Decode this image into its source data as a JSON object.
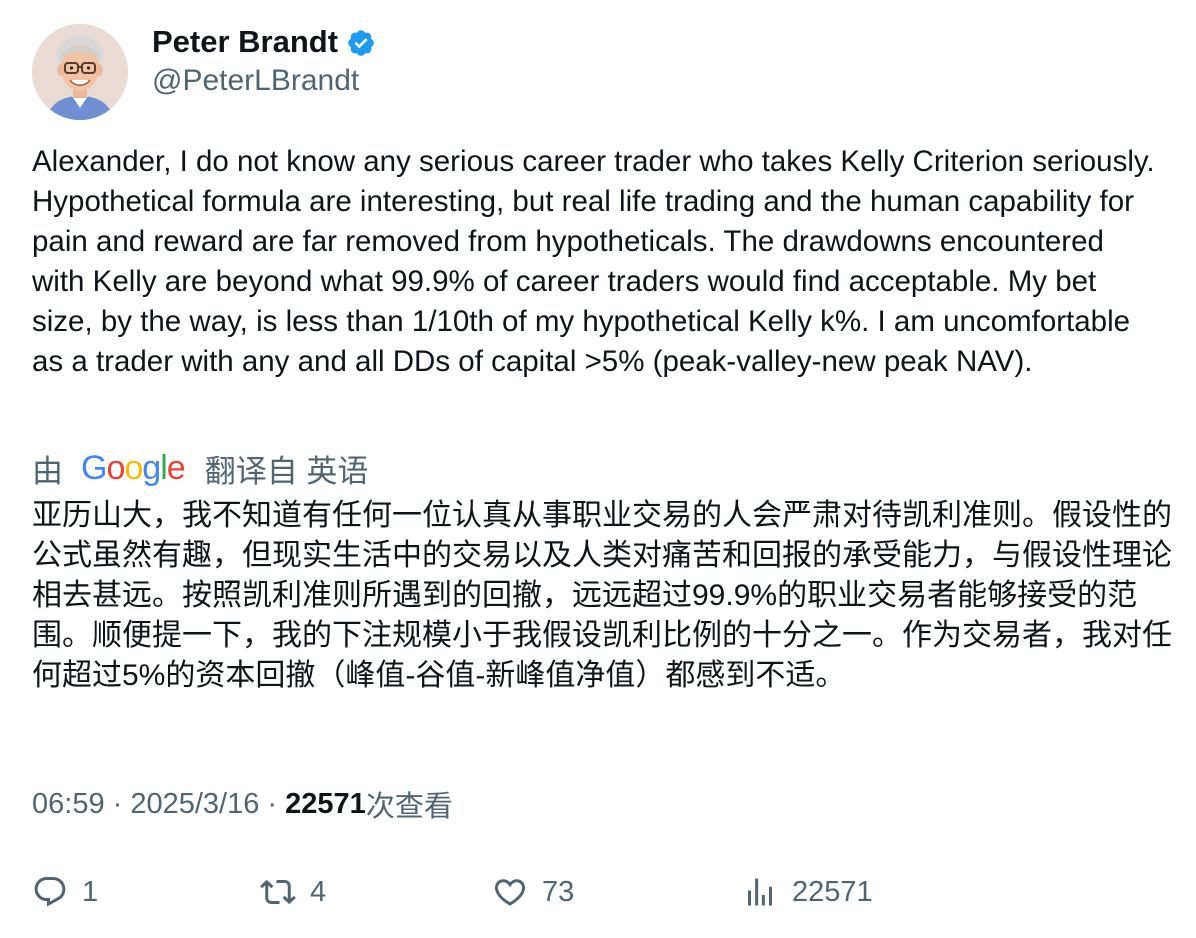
{
  "author": {
    "display_name": "Peter Brandt",
    "handle": "@PeterLBrandt",
    "verified": true
  },
  "tweet": {
    "text": "Alexander, I do not know any serious career trader who takes Kelly Criterion seriously. Hypothetical formula are interesting, but real life trading and the human capability for pain and reward are far removed from hypotheticals. The drawdowns encountered with Kelly are beyond what 99.9% of career traders would find acceptable. My bet size, by the way, is less than 1/10th of my hypothetical Kelly k%. I am uncomfortable as a trader with any and all DDs of capital >5% (peak-valley-new peak NAV)."
  },
  "translation": {
    "prefix": "由",
    "provider": "Google",
    "suffix": "翻译自 英语",
    "text": "亚历山大，我不知道有任何一位认真从事职业交易的人会严肃对待凯利准则。假设性的公式虽然有趣，但现实生活中的交易以及人类对痛苦和回报的承受能力，与假设性理论相去甚远。按照凯利准则所遇到的回撤，远远超过99.9%的职业交易者能够接受的范围。顺便提一下，我的下注规模小于我假设凯利比例的十分之一。作为交易者，我对任何超过5%的资本回撤（峰值-谷值-新峰值净值）都感到不适。"
  },
  "meta": {
    "time": "06:59",
    "separator": " · ",
    "date": "2025/3/16",
    "views_count": "22571",
    "views_label": "次查看"
  },
  "actions": {
    "reply": {
      "icon": "reply-icon",
      "count": "1"
    },
    "retweet": {
      "icon": "retweet-icon",
      "count": "4"
    },
    "like": {
      "icon": "heart-icon",
      "count": "73"
    },
    "views": {
      "icon": "views-icon",
      "count": "22571"
    }
  },
  "colors": {
    "text_primary": "#0f1419",
    "text_secondary": "#536471",
    "verified_blue": "#1d9bf0",
    "background": "#ffffff"
  }
}
